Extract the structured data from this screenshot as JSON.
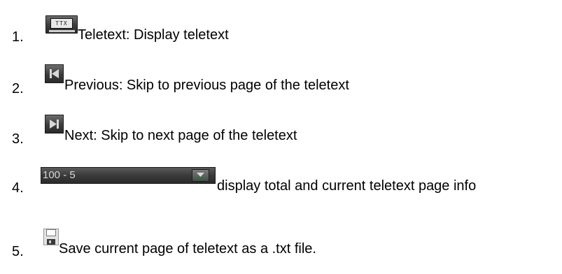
{
  "items": [
    {
      "number": "1.",
      "text": "Teletext: Display teletext",
      "icon": "teletext-icon",
      "icon_label": "TTX"
    },
    {
      "number": "2.",
      "text": "Previous: Skip to previous page of the teletext",
      "icon": "previous-icon"
    },
    {
      "number": "3.",
      "text": "Next: Skip to next page of the teletext",
      "icon": "next-icon"
    },
    {
      "number": "4.",
      "text": "display total and current teletext page info",
      "icon": "page-info-dropdown",
      "control_value": "100 - 5"
    },
    {
      "number": "5.",
      "text": "Save current page of teletext as a .txt file.",
      "icon": "save-icon"
    }
  ],
  "colors": {
    "icon_dark": "#3c3c3c",
    "icon_glyph": "#d9d9d9",
    "accent_green": "#1f7a34"
  }
}
